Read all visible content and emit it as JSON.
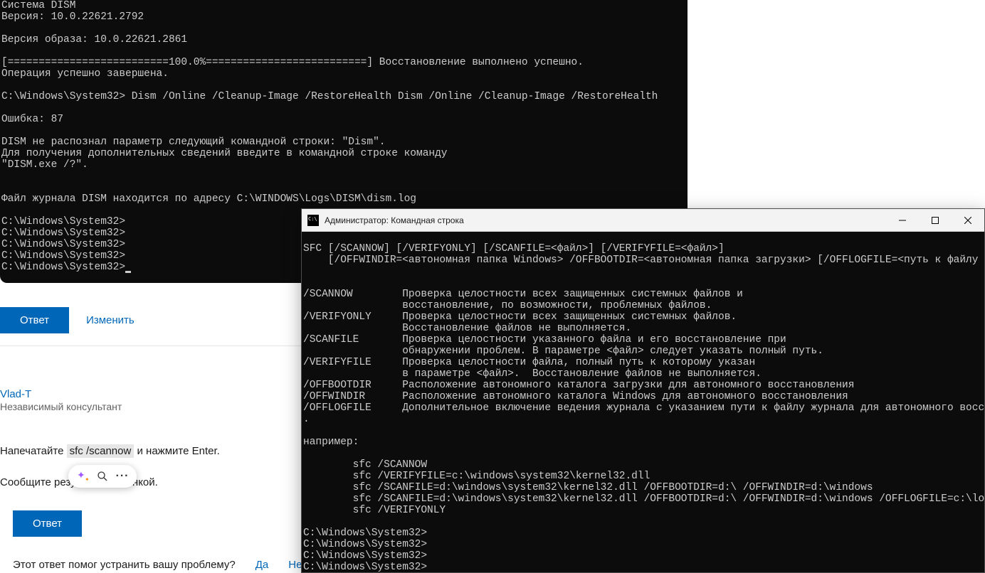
{
  "dism_terminal": {
    "lines": [
      "Cистема DISM",
      "Версия: 10.0.22621.2792",
      "",
      "Версия образа: 10.0.22621.2861",
      "",
      "[==========================100.0%==========================] Восстановление выполнено успешно.",
      "Операция успешно завершена.",
      "",
      "C:\\Windows\\System32> Dism /Online /Cleanup-Image /RestoreHealth Dism /Online /Cleanup-Image /RestoreHealth",
      "",
      "Ошибка: 87",
      "",
      "DISM не распознал параметр следующий командной строки: \"Dism\".",
      "Для получения дополнительных сведений введите в командной строке команду",
      "\"DISM.exe /?\".",
      "",
      "",
      "Файл журнала DISM находится по адресу C:\\WINDOWS\\Logs\\DISM\\dism.log",
      "",
      "C:\\Windows\\System32>",
      "C:\\Windows\\System32>",
      "C:\\Windows\\System32>",
      "C:\\Windows\\System32>",
      "C:\\Windows\\System32>"
    ]
  },
  "forum": {
    "answer_btn": "Ответ",
    "edit_link": "Изменить",
    "author_name": "Vlad-T",
    "author_role": "Независимый консультант",
    "instr1_prefix": "Напечатайте ",
    "instr1_code": "sfc /scannow",
    "instr1_suffix": " и нажмите Enter.",
    "instr2": "Сообщите результат картинкой.",
    "feedback_question": "Этот ответ помог устранить вашу проблему?",
    "yes": "Да",
    "no": "Нет"
  },
  "cmd_window": {
    "title": "Администратор: Командная строка",
    "lines": [
      "",
      "SFC [/SCANNOW] [/VERIFYONLY] [/SCANFILE=<файл>] [/VERIFYFILE=<файл>]",
      "    [/OFFWINDIR=<автономная папка Windows> /OFFBOOTDIR=<автономная папка загрузки> [/OFFLOGFILE=<путь к файлу журнала>]]",
      "",
      "",
      "/SCANNOW        Проверка целостности всех защищенных системных файлов и",
      "                восстановление, по возможности, проблемных файлов.",
      "/VERIFYONLY     Проверка целостности всех защищенных системных файлов.",
      "                Восстановление файлов не выполняется.",
      "/SCANFILE       Проверка целостности указанного файла и его восстановление при",
      "                обнаружении проблем. В параметре <файл> следует указать полный путь.",
      "/VERIFYFILE     Проверка целостности файла, полный путь к которому указан",
      "                в параметре <файл>.  Восстановление файлов не выполняется.",
      "/OFFBOOTDIR     Расположение автономного каталога загрузки для автономного восстановления",
      "/OFFWINDIR      Расположение автономного каталога Windows для автономного восстановления",
      "/OFFLOGFILE     Дополнительное включение ведения журнала с указанием пути к файлу журнала для автономного восстановления",
      ".",
      "",
      "например:",
      "",
      "        sfc /SCANNOW",
      "        sfc /VERIFYFILE=c:\\windows\\system32\\kernel32.dll",
      "        sfc /SCANFILE=d:\\windows\\system32\\kernel32.dll /OFFBOOTDIR=d:\\ /OFFWINDIR=d:\\windows",
      "        sfc /SCANFILE=d:\\windows\\system32\\kernel32.dll /OFFBOOTDIR=d:\\ /OFFWINDIR=d:\\windows /OFFLOGFILE=c:\\log.txt",
      "        sfc /VERIFYONLY",
      "",
      "C:\\Windows\\System32>",
      "C:\\Windows\\System32>",
      "C:\\Windows\\System32>",
      "C:\\Windows\\System32>"
    ]
  }
}
